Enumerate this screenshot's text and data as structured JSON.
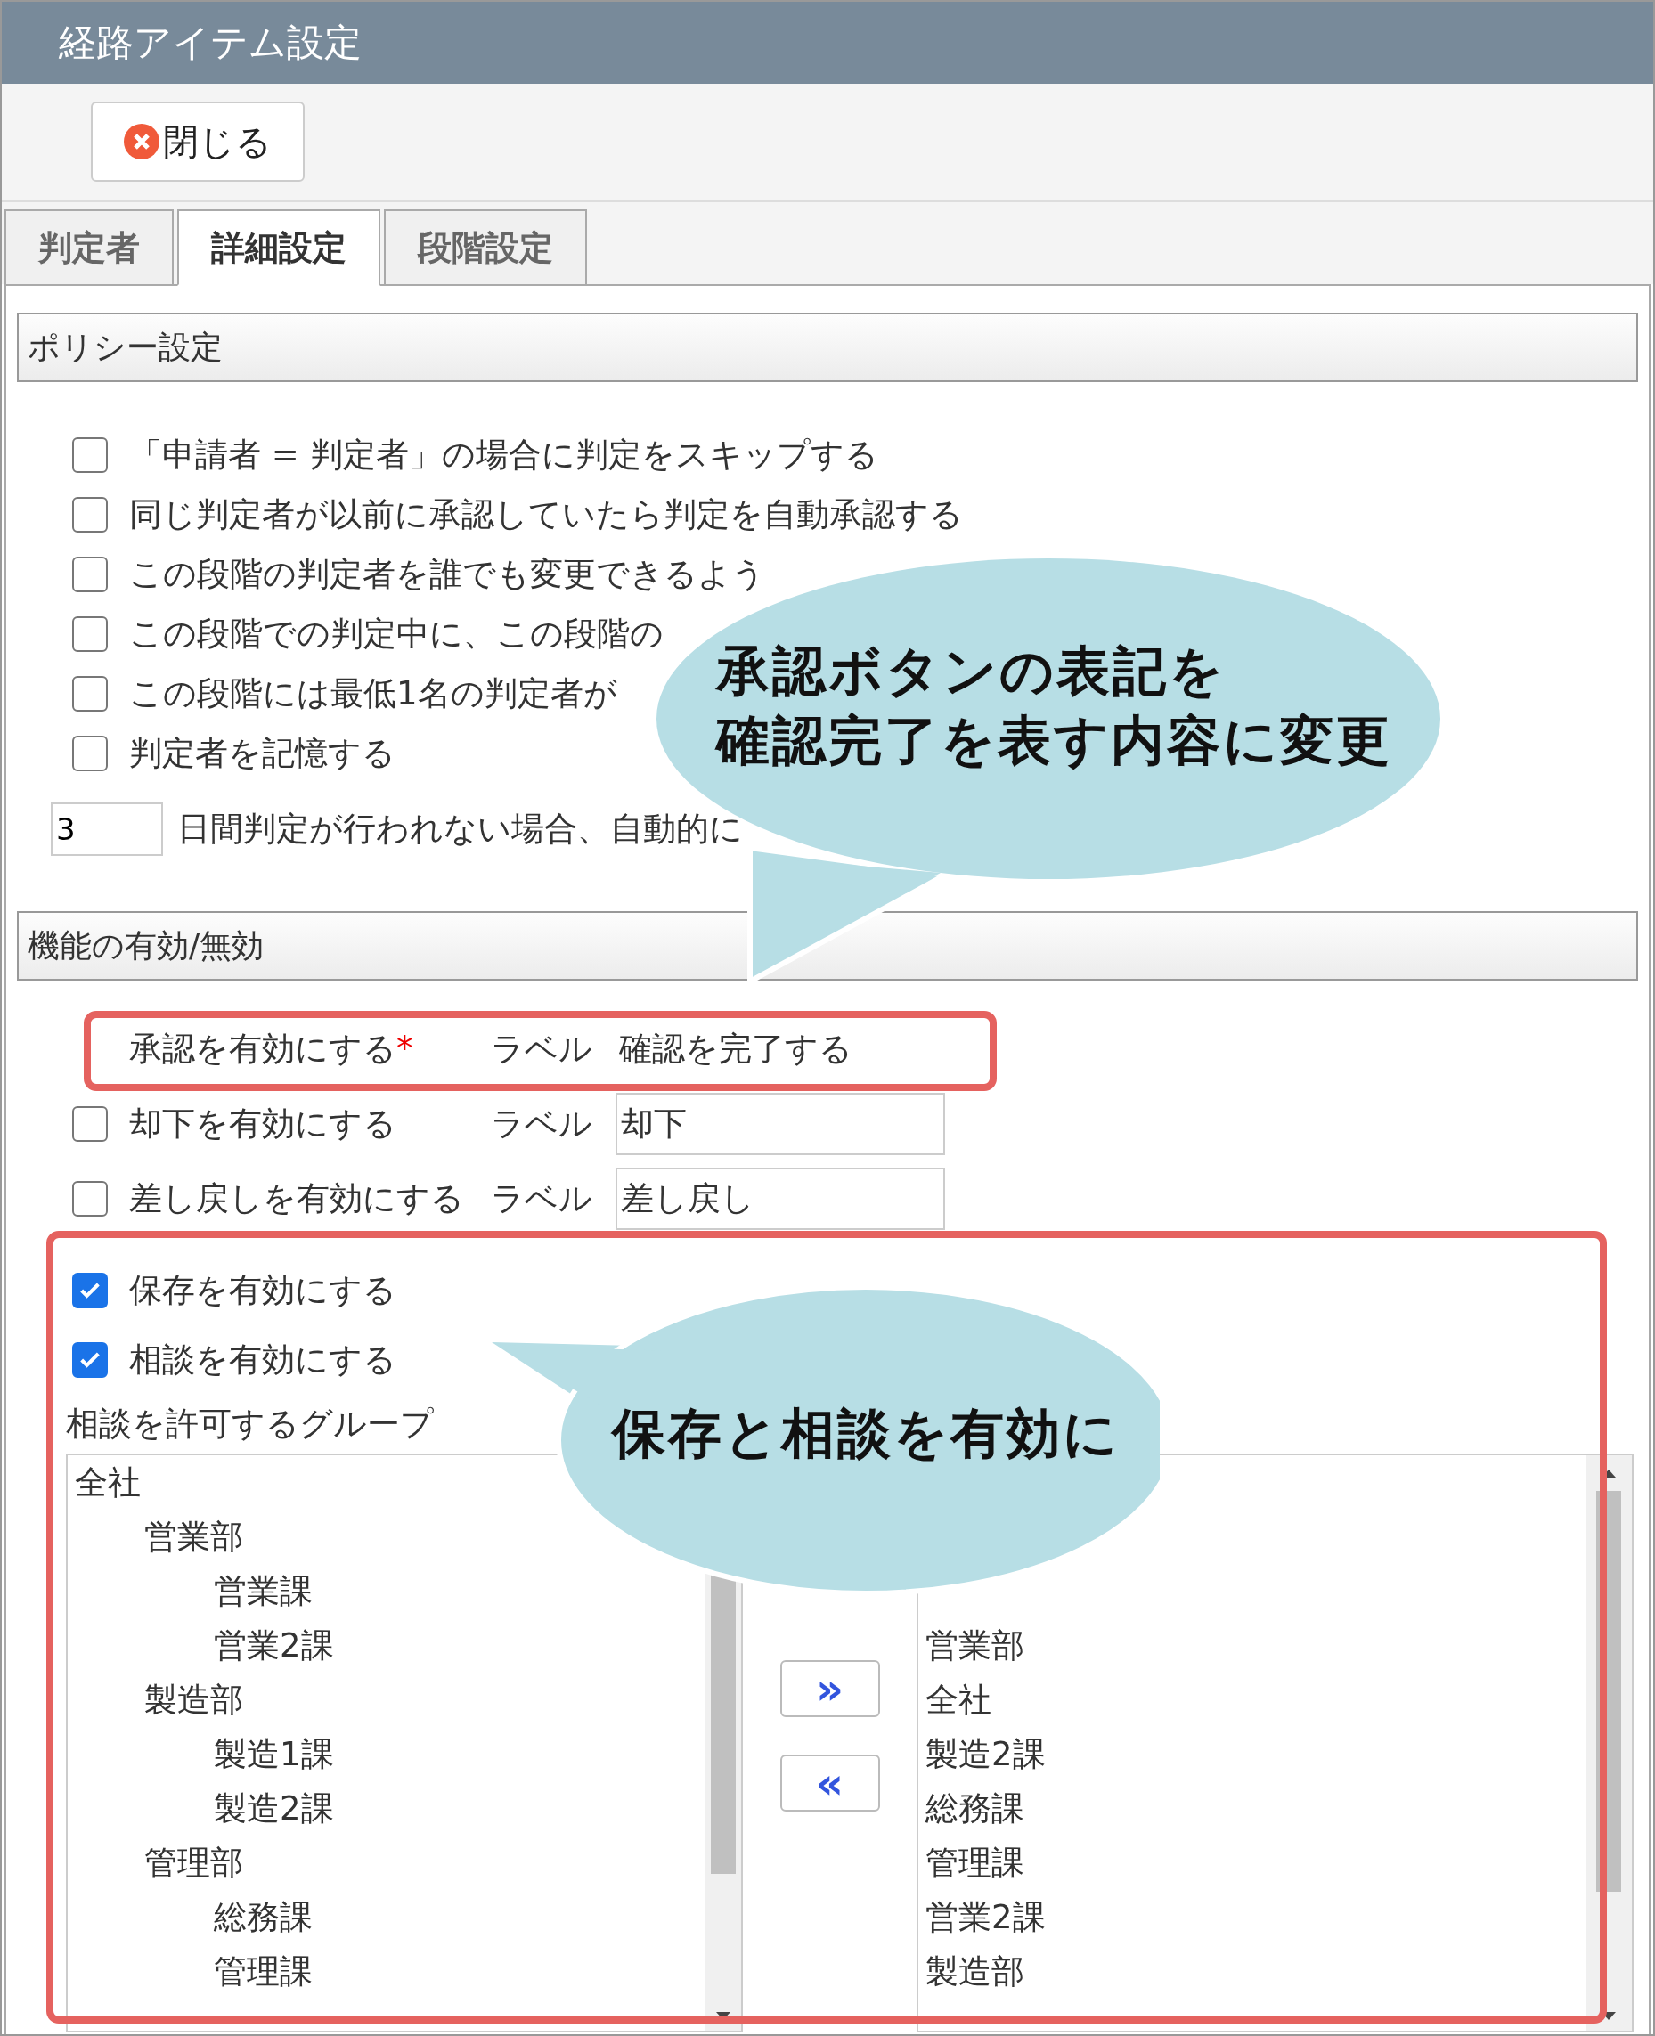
{
  "window": {
    "title": "経路アイテム設定"
  },
  "toolbar": {
    "close_button": "閉じる"
  },
  "tabs": [
    {
      "label": "判定者",
      "selected": false
    },
    {
      "label": "詳細設定",
      "selected": true
    },
    {
      "label": "段階設定",
      "selected": false
    }
  ],
  "policy": {
    "heading": "ポリシー設定",
    "options": [
      {
        "label": "「申請者 = 判定者」の場合に判定をスキップする",
        "checked": false
      },
      {
        "label": "同じ判定者が以前に承認していたら判定を自動承認する",
        "checked": false
      },
      {
        "label": "この段階の判定者を誰でも変更できるよう",
        "checked": false
      },
      {
        "label": "この段階での判定中に、この段階の",
        "checked": false
      },
      {
        "label": "この段階には最低1名の判定者が",
        "checked": false
      },
      {
        "label": "判定者を記憶する",
        "checked": false
      }
    ],
    "days": {
      "value": "3",
      "label": "日間判定が行われない場合、自動的に"
    }
  },
  "features": {
    "heading": "機能の有効/無効",
    "actions": [
      {
        "kind": "required",
        "label": "承認を有効にする",
        "mark": "*",
        "label_caption": "ラベル",
        "value": "確認を完了する"
      },
      {
        "kind": "checkbox",
        "label": "却下を有効にする",
        "checked": false,
        "label_caption": "ラベル",
        "value": "却下"
      },
      {
        "kind": "checkbox",
        "label": "差し戻しを有効にする",
        "checked": false,
        "label_caption": "ラベル",
        "value": "差し戻し"
      },
      {
        "kind": "toggle",
        "label": "保存を有効にする",
        "checked": true
      },
      {
        "kind": "toggle",
        "label": "相談を有効にする",
        "checked": true
      }
    ],
    "group_label": "相談を許可するグループ",
    "available_groups": [
      {
        "label": "全社",
        "children": [
          {
            "label": "営業部",
            "children": [
              {
                "label": "営業課"
              },
              {
                "label": "営業2課"
              }
            ]
          },
          {
            "label": "製造部",
            "children": [
              {
                "label": "製造1課"
              },
              {
                "label": "製造2課"
              }
            ]
          },
          {
            "label": "管理部",
            "children": [
              {
                "label": "総務課"
              },
              {
                "label": "管理課"
              }
            ]
          }
        ]
      }
    ],
    "add_button": "»",
    "remove_button": "«",
    "allowed_groups": [
      "営業部",
      "全社",
      "製造2課",
      "総務課",
      "管理課",
      "営業2課",
      "製造部"
    ]
  },
  "annotations": [
    {
      "lines": [
        "承認ボタンの表記を",
        "確認完了を表す内容に変更"
      ]
    },
    {
      "lines": [
        "保存と相談を有効に"
      ]
    }
  ]
}
